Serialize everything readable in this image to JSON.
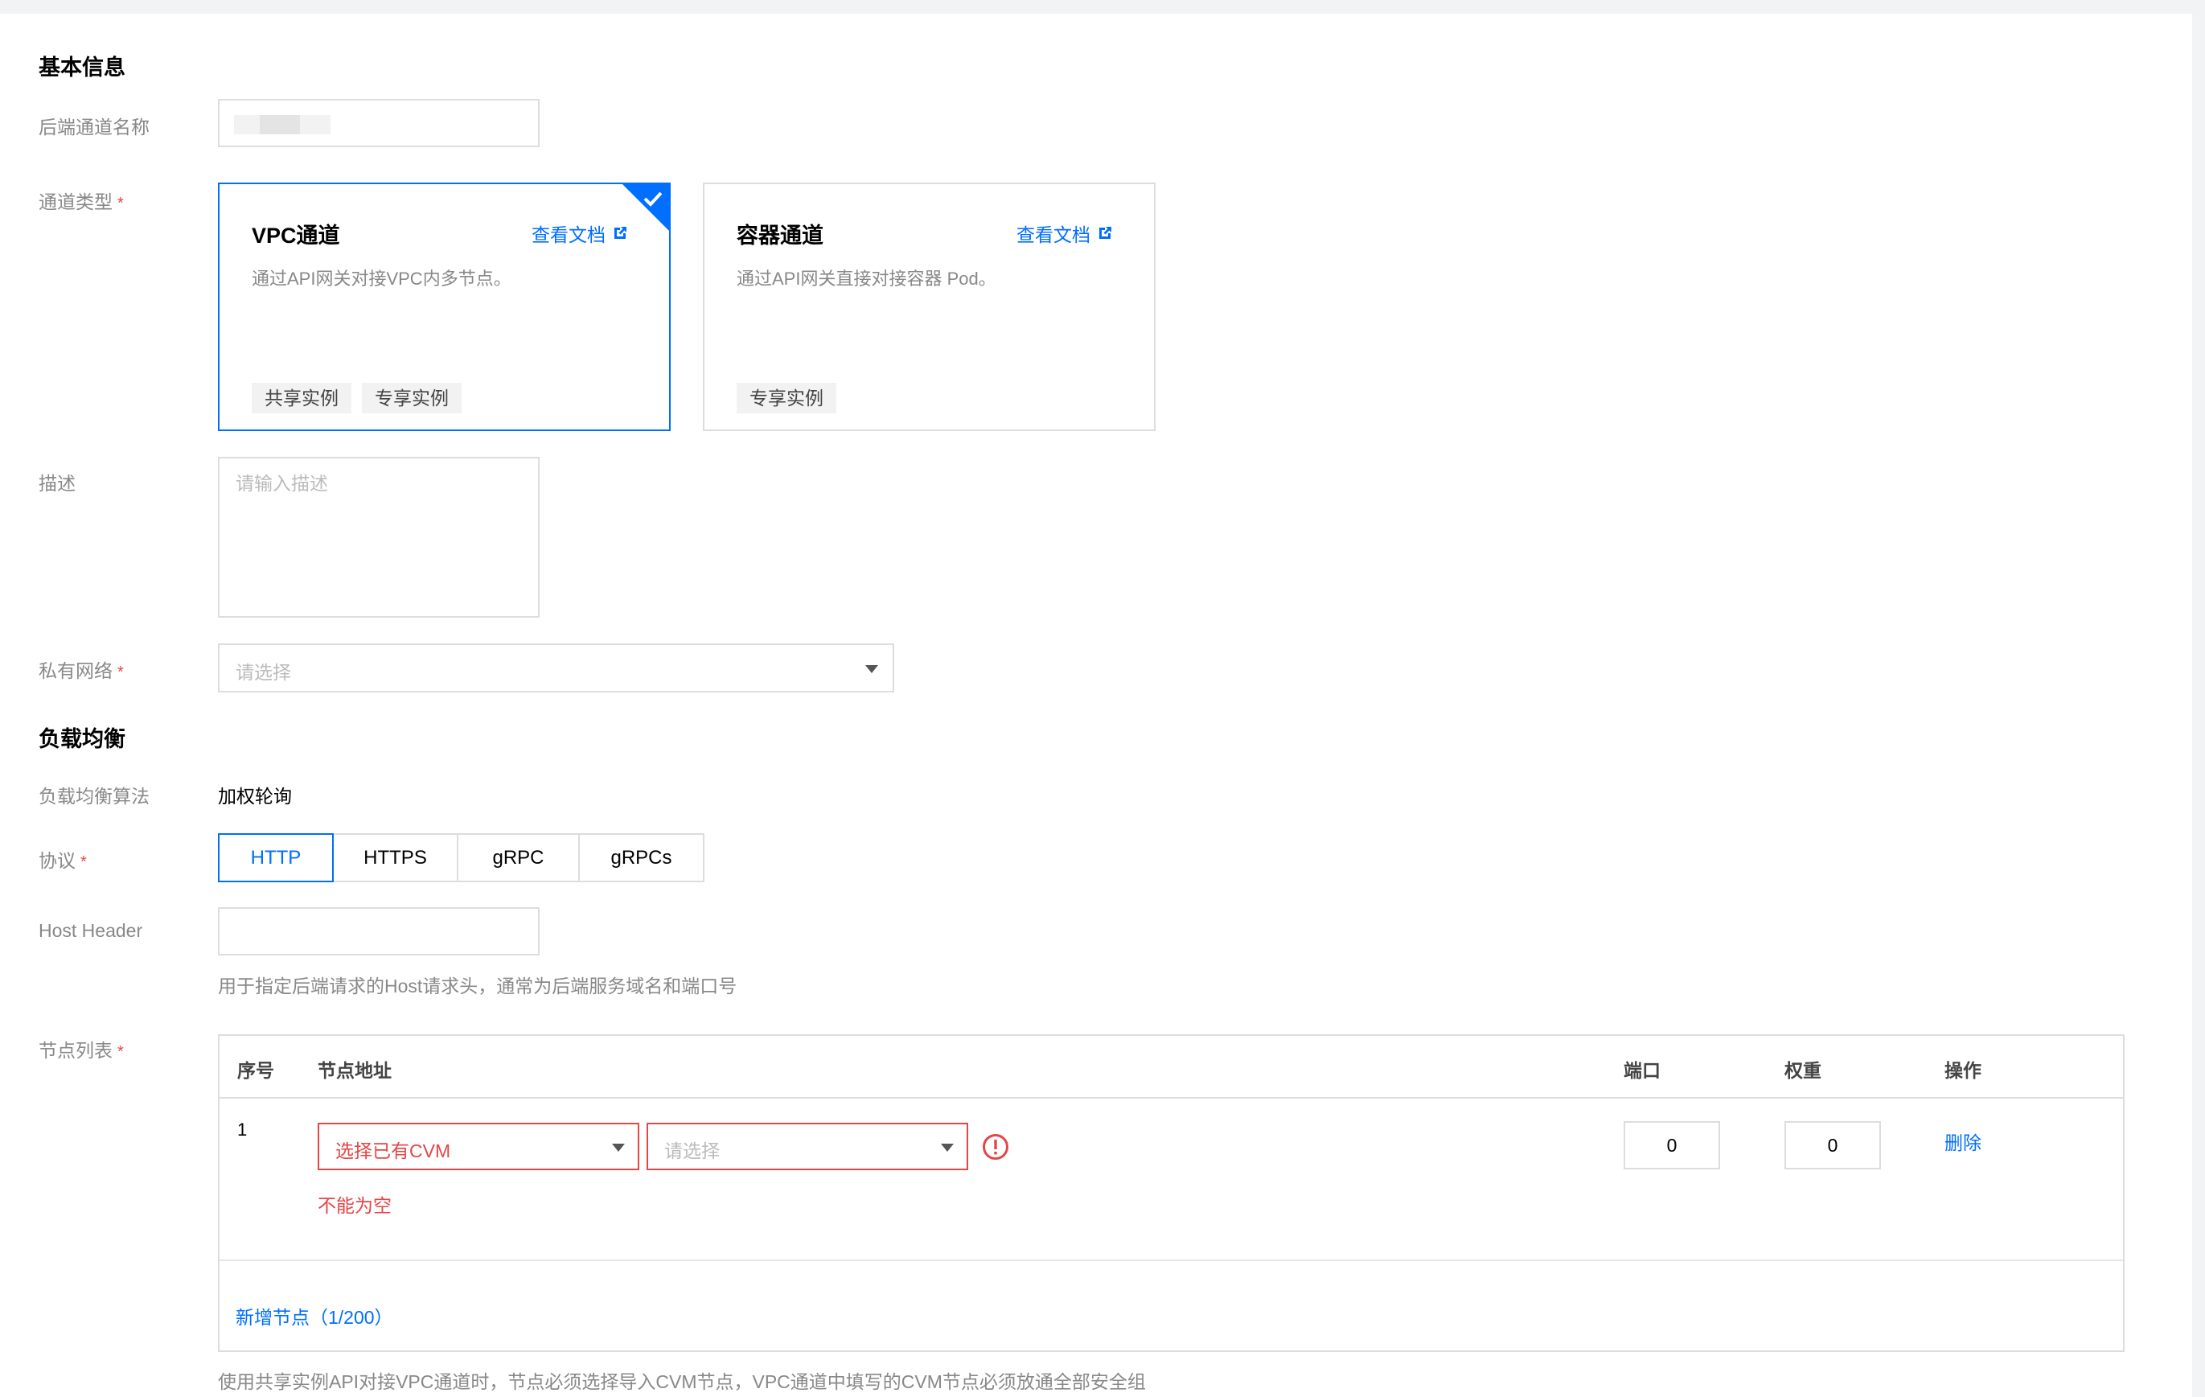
{
  "basic": {
    "section_title": "基本信息",
    "channel_name_label": "后端通道名称",
    "channel_name_value": "",
    "channel_type_label": "通道类型",
    "description_label": "描述",
    "description_placeholder": "请输入描述",
    "vpc_label": "私有网络",
    "vpc_placeholder": "请选择"
  },
  "channel_cards": [
    {
      "title": "VPC通道",
      "link": "查看文档",
      "desc": "通过API网关对接VPC内多节点。",
      "tags": [
        "共享实例",
        "专享实例"
      ],
      "selected": true
    },
    {
      "title": "容器通道",
      "link": "查看文档",
      "desc": "通过API网关直接对接容器 Pod。",
      "tags": [
        "专享实例"
      ],
      "selected": false
    }
  ],
  "lb": {
    "section_title": "负载均衡",
    "algorithm_label": "负载均衡算法",
    "algorithm_value": "加权轮询",
    "protocol_label": "协议",
    "protocols": [
      "HTTP",
      "HTTPS",
      "gRPC",
      "gRPCs"
    ],
    "protocol_selected": "HTTP",
    "host_header_label": "Host Header",
    "host_header_value": "",
    "host_header_hint": "用于指定后端请求的Host请求头，通常为后端服务域名和端口号"
  },
  "nodes": {
    "label": "节点列表",
    "columns": {
      "index": "序号",
      "address": "节点地址",
      "port": "端口",
      "weight": "权重",
      "action": "操作"
    },
    "rows": [
      {
        "index": "1",
        "source_select": "选择已有CVM",
        "node_placeholder": "请选择",
        "error": "不能为空",
        "port": "0",
        "weight": "0",
        "action": "删除"
      }
    ],
    "add_link": "新增节点（1/200）",
    "footer_hint": "使用共享实例API对接VPC通道时，节点必须选择导入CVM节点，VPC通道中填写的CVM节点必须放通全部安全组"
  },
  "colors": {
    "accent": "#006eff",
    "error": "#e54545",
    "border": "#dddddd",
    "muted": "#888888"
  }
}
